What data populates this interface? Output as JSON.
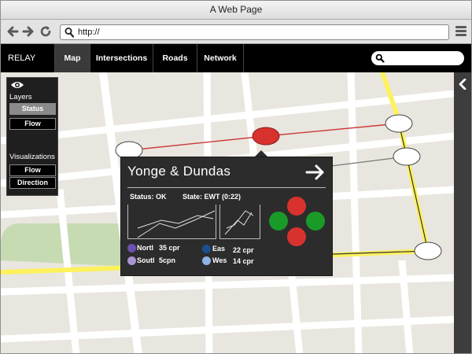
{
  "window": {
    "title": "A Web Page"
  },
  "toolbar": {
    "url": "http://"
  },
  "appnav": {
    "brand": "RELAY",
    "tabs": [
      {
        "label": "Map",
        "active": true
      },
      {
        "label": "Intersections",
        "active": false
      },
      {
        "label": "Roads",
        "active": false
      },
      {
        "label": "Network",
        "active": false
      }
    ],
    "search_value": ""
  },
  "layers_panel": {
    "layers_heading": "Layers",
    "layer_items": [
      {
        "label": "Status",
        "active": true
      },
      {
        "label": "Flow",
        "active": false
      }
    ],
    "viz_heading": "Visualizations",
    "viz_items": [
      {
        "label": "Flow",
        "active": false
      },
      {
        "label": "Direction",
        "active": false
      }
    ]
  },
  "popup": {
    "title": "Yonge & Dundas",
    "status_text": "Status: OK",
    "state_text": "State: EWT (0:22)",
    "legend": [
      {
        "label": "Nortl",
        "value": "35 cpr",
        "color": "#6a52b0"
      },
      {
        "label": "Eas",
        "value": "22 cpr",
        "color": "#1d4f8f"
      },
      {
        "label": "Soutl",
        "value": "5cpn",
        "color": "#a995cf"
      },
      {
        "label": "Wes",
        "value": "14 cpr",
        "color": "#8fb2e3"
      }
    ],
    "signals": {
      "north": "#d8322e",
      "east": "#1a9a27",
      "south": "#d8322e",
      "west": "#1a9a27"
    }
  },
  "colors": {
    "map_bg": "#e9e6df",
    "road": "#ffffff",
    "highway": "#fdf15d",
    "park": "#c6dbb2",
    "route_red": "#c93a36",
    "route_gray": "#777777",
    "selected_node": "#d8322e"
  },
  "icons": {
    "back": "arrow-left-icon",
    "forward": "arrow-right-icon",
    "reload": "reload-icon",
    "menu": "hamburger-menu-icon",
    "search": "search-icon",
    "layers": "eye-icon",
    "expand": "chevron-left-icon",
    "navigate": "arrow-right-icon"
  }
}
